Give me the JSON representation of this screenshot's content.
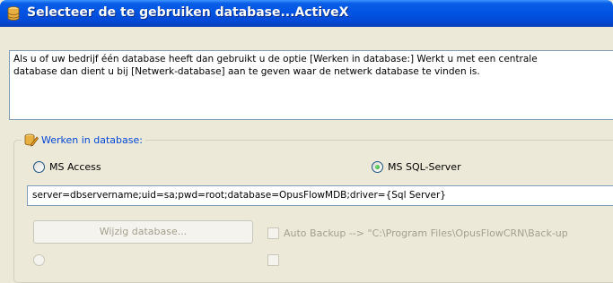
{
  "window": {
    "title": "Selecteer de te gebruiken database...ActiveX",
    "icon": "database-icon"
  },
  "description": {
    "line1": "Als u of uw bedrijf één database heeft dan gebruikt u de optie [Werken in database:] Werkt u met een centrale",
    "line2": "database dan dient u bij [Netwerk-database] aan te geven waar de netwerk database te vinden is."
  },
  "group": {
    "label": "Werken in database:",
    "icon": "database-edit-icon",
    "options": [
      {
        "label": "MS Access",
        "selected": false
      },
      {
        "label": "MS SQL-Server",
        "selected": true
      }
    ],
    "connection_string": "server=dbservername;uid=sa;pwd=root;database=OpusFlowMDB;driver={Sql Server}",
    "change_button": "Wijzig database...",
    "auto_backup_label": "Auto Backup --> \"C:\\Program Files\\OpusFlowCRN\\Back-up",
    "auto_backup_checked": false
  },
  "colors": {
    "titlebar": "#0054e3",
    "legend_text": "#0046d5",
    "window_bg": "#ece9d8"
  }
}
